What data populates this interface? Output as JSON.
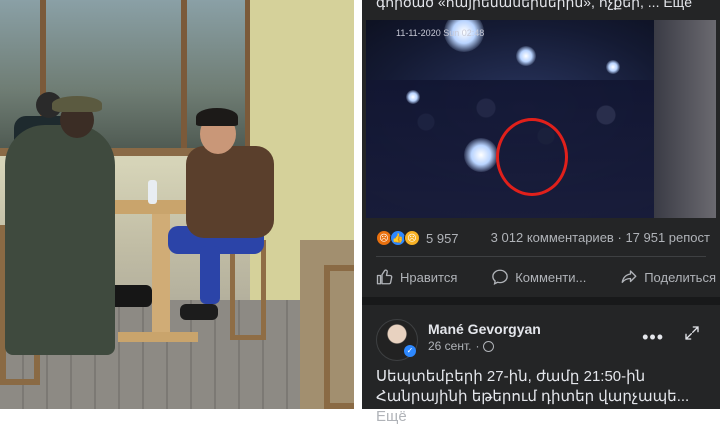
{
  "photo": {},
  "video_post": {
    "caption": "գործած «հայրենասերներին», ոչքեր, ... Ещё",
    "timestamp": "11-11-2020  Sun 02:48"
  },
  "reactions": {
    "icons": [
      "angry-icon",
      "like-icon",
      "sad-icon"
    ],
    "count": "5 957",
    "comments": "3 012 комментариев",
    "separator": "·",
    "reposts": "17 951 репост"
  },
  "actions": {
    "like_label": "Нравится",
    "comment_label": "Комменти...",
    "share_label": "Поделиться"
  },
  "post": {
    "author": "Mané Gevorgyan",
    "date": "26 сент.",
    "date_separator": "·",
    "text_line1": "Սեպտեմբերի 27-ին, ժամը 21:50-ին",
    "text_line2": "Հանրայինի եթերում դիտեր վարչապե...",
    "more_label": "Ещё"
  },
  "colors": {
    "fb_bg": "#242526",
    "fb_text": "#e4e6eb",
    "fb_secondary": "#b0b3b8",
    "circle_annotation": "#e0201b"
  }
}
